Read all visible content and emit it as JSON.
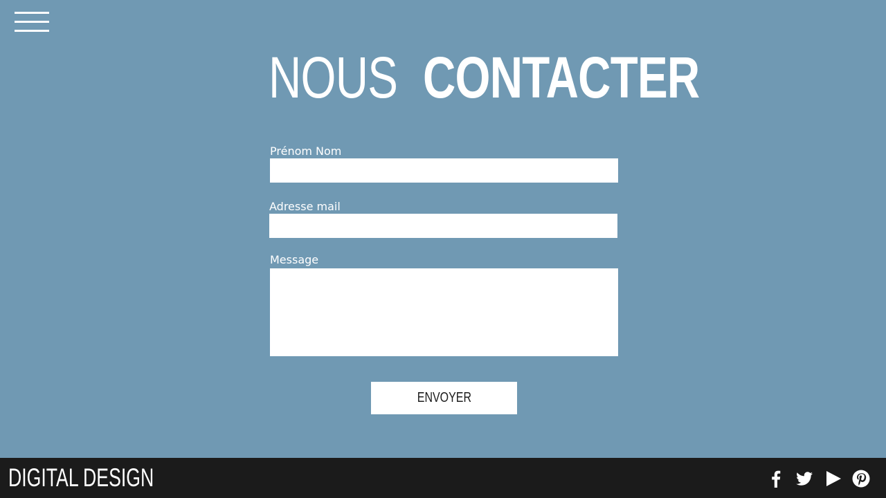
{
  "header": {
    "menu_icon": "hamburger-menu-icon",
    "title_light": "NOUS",
    "title_bold": "CONTACTER"
  },
  "form": {
    "name_label": "Prénom Nom",
    "name_value": "",
    "email_label": "Adresse mail",
    "email_value": "",
    "message_label": "Message",
    "message_value": "",
    "submit_label": "ENVOYER"
  },
  "footer": {
    "brand": "DIGITAL DESIGN",
    "social_icons": [
      "facebook-icon",
      "twitter-icon",
      "youtube-play-icon",
      "pinterest-icon"
    ]
  },
  "colors": {
    "background": "#7099b3",
    "footer": "#1b1b1b",
    "text": "#ffffff",
    "field": "#ffffff"
  }
}
